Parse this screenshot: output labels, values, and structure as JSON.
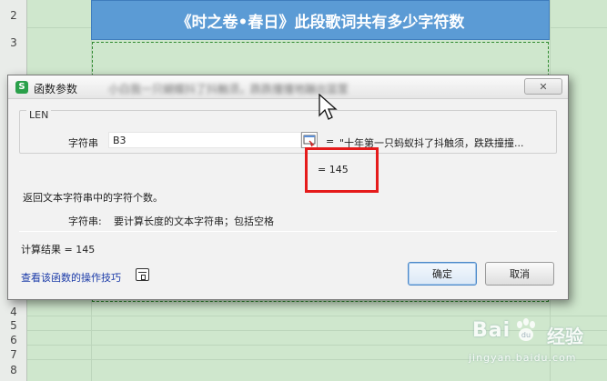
{
  "spreadsheet": {
    "title_cell": "《时之卷•春日》此段歌词共有多少字符数",
    "row_numbers": [
      "2",
      "3",
      "4",
      "5",
      "6",
      "7",
      "8"
    ]
  },
  "dialog": {
    "title": "函数参数",
    "blurred_text": "小白我一只蝴蝶抖了抖触须，跌跌撞撞地蹦出篮筐",
    "close_label": "✕",
    "function_name": "LEN",
    "argument": {
      "label": "字符串",
      "value": "B3",
      "eq": "=",
      "preview": "\"十年第一只蚂蚁抖了抖触须，跌跌撞撞..."
    },
    "result_eq": "= 145",
    "description": "返回文本字符串中的字符个数。",
    "param": {
      "name": "字符串:",
      "desc": "要计算长度的文本字符串；包括空格"
    },
    "calc_result": "计算结果 =  145",
    "help_link": "查看该函数的操作技巧",
    "ok_label": "确定",
    "cancel_label": "取消",
    "highlight_color": "#e51b1b"
  },
  "watermark": {
    "brand": "Bai",
    "brand_cn": "经验",
    "url": "jingyan.baidu.com"
  }
}
